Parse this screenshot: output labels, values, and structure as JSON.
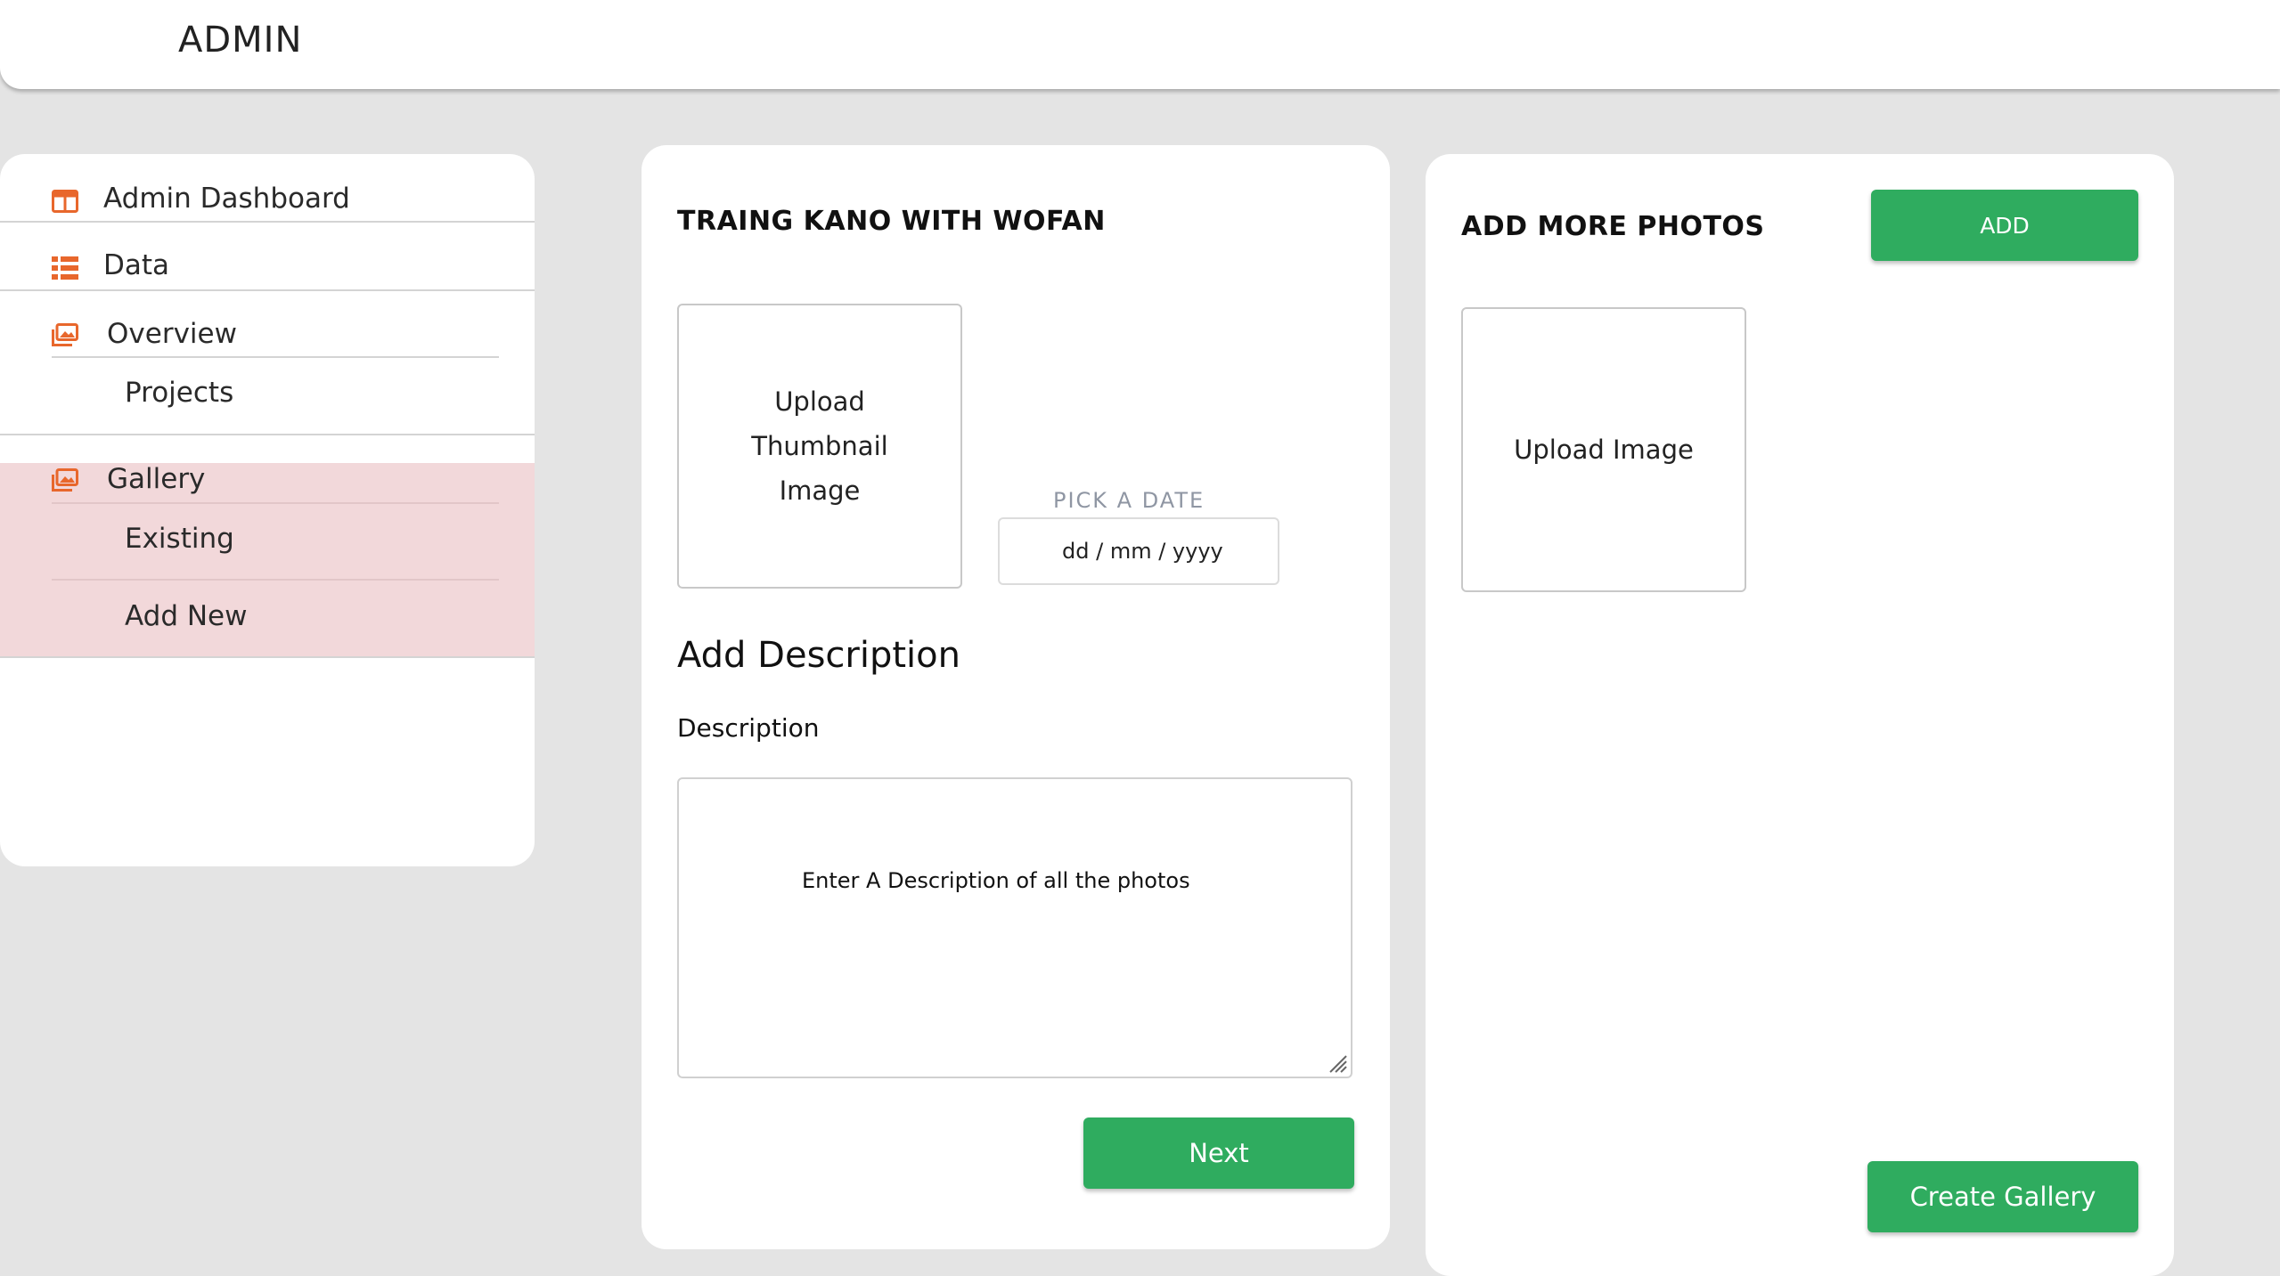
{
  "app": {
    "title": "ADMIN"
  },
  "sidebar": {
    "items": [
      {
        "label": "Admin Dashboard",
        "icon": "dashboard-icon"
      },
      {
        "label": "Data",
        "icon": "list-icon"
      },
      {
        "label": "Overview",
        "icon": "images-icon",
        "children": [
          "Projects"
        ]
      },
      {
        "label": "Gallery",
        "icon": "images-icon",
        "active": true,
        "children": [
          "Existing",
          "Add New"
        ]
      }
    ]
  },
  "gallery_form": {
    "title": "TRAING KANO WITH WOFAN",
    "thumbnail_upload_label": "Upload Thumbnail Image",
    "date_label": "PICK A DATE",
    "date_placeholder": "dd / mm / yyyy",
    "section_heading": "Add Description",
    "description_label": "Description",
    "description_placeholder": "Enter A Description of all the photos",
    "next_button": "Next"
  },
  "more_photos": {
    "title": "ADD MORE PHOTOS",
    "add_button": "ADD",
    "upload_label": "Upload Image",
    "create_button": "Create Gallery"
  },
  "colors": {
    "accent_icon": "#e8672c",
    "primary_green": "#2fac5f",
    "active_bg": "#f2d8da",
    "page_bg": "#e4e4e4"
  }
}
